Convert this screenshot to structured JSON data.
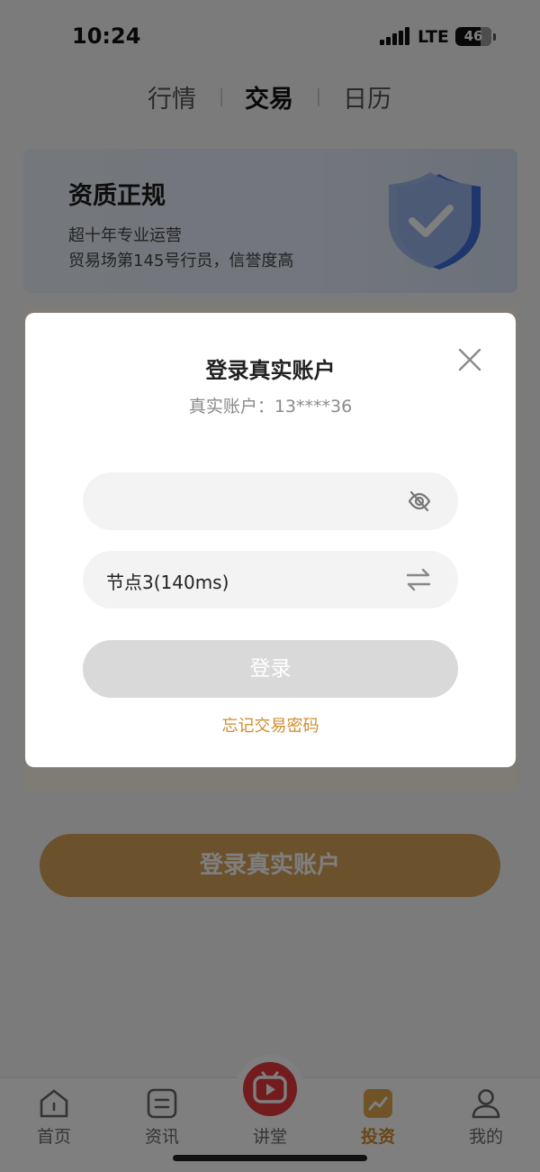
{
  "status_bar": {
    "time": "10:24",
    "network": "LTE",
    "battery": "46"
  },
  "top_tabs": [
    {
      "label": "行情"
    },
    {
      "label": "交易"
    },
    {
      "label": "日历"
    }
  ],
  "active_top_tab": "交易",
  "banner": {
    "title": "资质正规",
    "line1": "超十年专业运营",
    "line2": "贸易场第145号行员，信誉度高"
  },
  "background_login_button": "登录真实账户",
  "modal": {
    "title": "登录真实账户",
    "account_line": "真实账户：13****36",
    "password_placeholder": "",
    "node_label": "节点3(140ms)",
    "login_button": "登录",
    "forgot_link": "忘记交易密码"
  },
  "tabbar": [
    {
      "label": "首页",
      "icon": "home-icon"
    },
    {
      "label": "资讯",
      "icon": "news-icon"
    },
    {
      "label": "讲堂",
      "icon": "tv-play-icon"
    },
    {
      "label": "投资",
      "icon": "invest-icon"
    },
    {
      "label": "我的",
      "icon": "profile-icon"
    }
  ],
  "active_tabbar_item": "投资",
  "colors": {
    "accent_gold": "#cf8d30",
    "button_gold": "#d9a35a",
    "disabled_button": "#d9d9d9",
    "live_red": "#e4393c"
  }
}
